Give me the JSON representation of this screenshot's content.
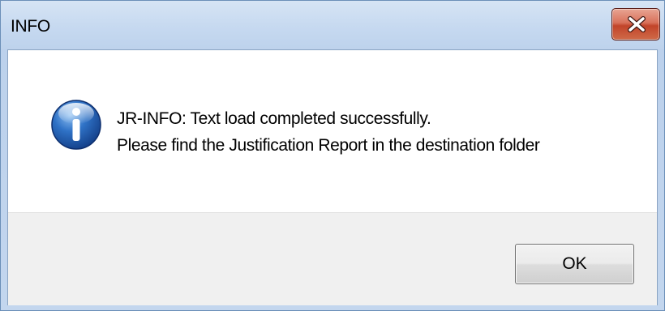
{
  "window": {
    "title": "INFO",
    "close_icon": "close-icon"
  },
  "dialog": {
    "icon": "information-icon",
    "message_line1": "JR-INFO: Text load completed successfully.",
    "message_line2": "Please find the Justification Report in the destination folder"
  },
  "buttons": {
    "ok_label": "OK"
  },
  "colors": {
    "titlebar": "#c6d9f0",
    "close_button": "#c2442a",
    "info_icon": "#1f5fb5",
    "footer": "#f0f0f0"
  }
}
